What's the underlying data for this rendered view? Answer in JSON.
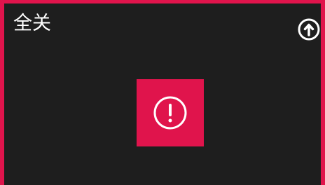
{
  "header": {
    "title": "全关"
  },
  "icons": {
    "up_button": "arrow-up-circle-icon",
    "alert": "exclamation-circle-icon"
  },
  "colors": {
    "accent": "#e0144c",
    "background": "#1e1e1e",
    "foreground": "#ffffff"
  }
}
